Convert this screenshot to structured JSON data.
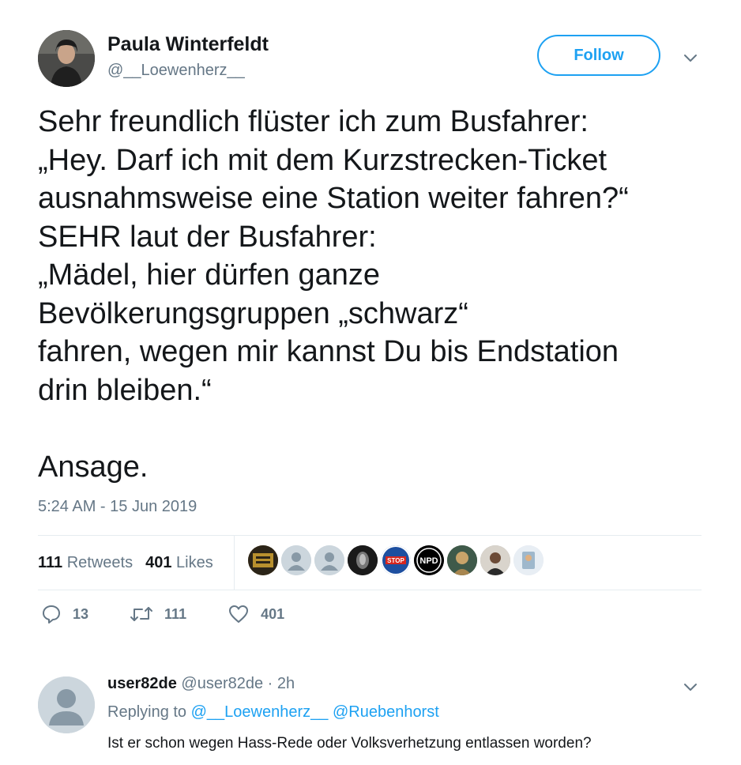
{
  "tweet": {
    "author_name": "Paula Winterfeldt",
    "author_handle": "@__Loewenherz__",
    "follow_label": "Follow",
    "text": "Sehr freundlich flüster ich zum Busfahrer:\n„Hey. Darf ich mit dem Kurzstrecken-Ticket\nausnahmsweise eine Station weiter fahren?“\nSEHR laut der Busfahrer:\n„Mädel, hier dürfen ganze\nBevölkerungsgruppen „schwarz“\nfahren, wegen mir kannst Du bis Endstation\ndrin bleiben.“\n\nAnsage.",
    "timestamp": "5:24 AM - 15 Jun 2019",
    "retweets_count": "111",
    "retweets_label": "Retweets",
    "likes_count": "401",
    "likes_label": "Likes",
    "liker_badges": [
      "",
      "",
      "",
      "",
      "STOP",
      "NPD",
      "",
      "",
      ""
    ],
    "actions": {
      "reply_count": "13",
      "retweet_count": "111",
      "like_count": "401"
    }
  },
  "reply": {
    "name": "user82de",
    "handle": "@user82de",
    "separator": "·",
    "time": "2h",
    "replying_prefix": "Replying to",
    "mention_1": "@__Loewenherz__",
    "mention_2": "@Ruebenhorst",
    "text": "Ist er schon wegen Hass-Rede oder Volksverhetzung entlassen worden?"
  },
  "colors": {
    "accent": "#1da1f2",
    "text_primary": "#14171a",
    "text_secondary": "#657786",
    "divider": "#e6ecf0"
  },
  "icons": [
    "chevron-down-icon",
    "reply-icon",
    "retweet-icon",
    "heart-icon",
    "default-avatar-icon"
  ]
}
